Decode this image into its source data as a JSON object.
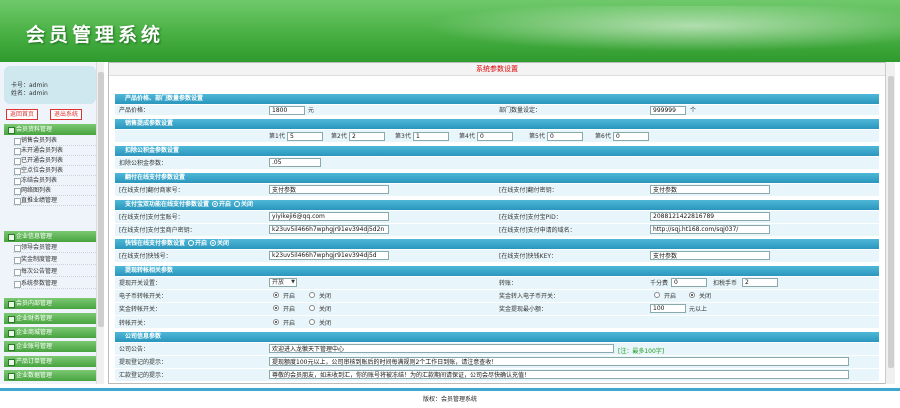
{
  "app": {
    "title": "会员管理系统"
  },
  "user": {
    "line1": "卡号：admin",
    "line2": "姓名：admin"
  },
  "top_buttons": [
    "返回首页",
    "退出系统"
  ],
  "menu": [
    {
      "label": "会员资料管理",
      "items": [
        "销售会员列表",
        "未开通会员列表",
        "已开通会员列表",
        "空点位会员列表",
        "冻结会员列表",
        "网络图列表",
        "直推业绩管理"
      ]
    },
    {
      "label": "企业信息管理",
      "items": [
        "领导会员管理",
        "奖金制度管理",
        "每次公告管理",
        "系统参数管理"
      ]
    },
    {
      "label": "会员内部管理",
      "items": []
    },
    {
      "label": "企业财务管理",
      "items": []
    },
    {
      "label": "企业商城管理",
      "items": []
    },
    {
      "label": "企业账号管理",
      "items": []
    },
    {
      "label": "产品订单管理",
      "items": []
    },
    {
      "label": "企业数据管理",
      "items": []
    }
  ],
  "main": {
    "title": "系统参数设置"
  },
  "s1": {
    "head": "产品价格、部门数量参数设置",
    "price_label": "产品价格：",
    "price": "1800",
    "price_unit": "元",
    "dept_label": "部门数量设定：",
    "dept": "999999",
    "dept_unit": "个"
  },
  "s2": {
    "head": "销售提成参数设置",
    "generations": [
      {
        "l": "第1代",
        "v": "5"
      },
      {
        "l": "第2代",
        "v": "2"
      },
      {
        "l": "第3代",
        "v": "1"
      },
      {
        "l": "第4代",
        "v": "0"
      },
      {
        "l": "第5代",
        "v": "0"
      },
      {
        "l": "第6代",
        "v": "0"
      }
    ]
  },
  "s3": {
    "head": "扣除公积金参数设置",
    "label": "扣除公积金参数：",
    "value": ".05"
  },
  "s4": {
    "head": "翻付在线支付参数设置",
    "l1": "[在线支付]翻付商家号：",
    "v1": "支付参数",
    "l2": "[在线支付]翻付密钥：",
    "v2": "支付参数"
  },
  "s5": {
    "head": "支付宝双功能在线支付参数设置",
    "on": "开启",
    "off": "关闭",
    "l1": "[在线支付]支付宝账号：",
    "v1": "yiyikeji6@qq.com",
    "l2": "[在线支付]支付宝PID：",
    "v2": "2088121422816789",
    "l3": "[在线支付]支付宝商户密钥：",
    "v3": "k23uv5il466h7wphgjr91ev394dj5d2n",
    "l4": "[在线支付]支付申请的域名：",
    "v4": "http://sqj.ht168.com/sqj037/"
  },
  "s6": {
    "head": "快钱在线支付参数设置",
    "on": "开启",
    "off": "关闭",
    "l1": "[在线支付]快钱号：",
    "v1": "k23uv5il466h7wphgjr91ev394dj5d",
    "l2": "[在线支付]快钱KEY：",
    "v2": "支付参数"
  },
  "s7": {
    "head": "提现转帐相关参数",
    "l_tx": "提现开关设置：",
    "tx_val": "开放",
    "l_fee": "转账：",
    "fee_a_label": "千分费",
    "fee_a": "0",
    "fee_b_label": "扣税手币",
    "fee_b": "2",
    "l_e": "电子币转帐开关：",
    "l_nj": "奖金转入电子币开关：",
    "l_zz": "奖金转帐开关：",
    "l_min": "奖金提现最小额：",
    "min": "100",
    "min_unit": "元以上",
    "l_sh": "转帐开关：",
    "on": "开启",
    "off": "关闭"
  },
  "s8": {
    "head": "公司信息参数",
    "l_notice": "公司公告：",
    "notice": "欢迎进入龙徽天下管理中心",
    "notice_tip": "[注：最多100字]",
    "l_login": "提现登记的提示：",
    "login": "提现额度100元以上，公司审核到账后的时间每满规则2个工作日到账，请注意查收！",
    "l_reg": "汇款登记的提示：",
    "reg": "尊敬的会员朋友，如未收到汇，你的账号将被冻结！为的汇款期间请保证，公司会尽快确认充值！"
  },
  "footer": {
    "text": "版权：会员管理系统"
  }
}
